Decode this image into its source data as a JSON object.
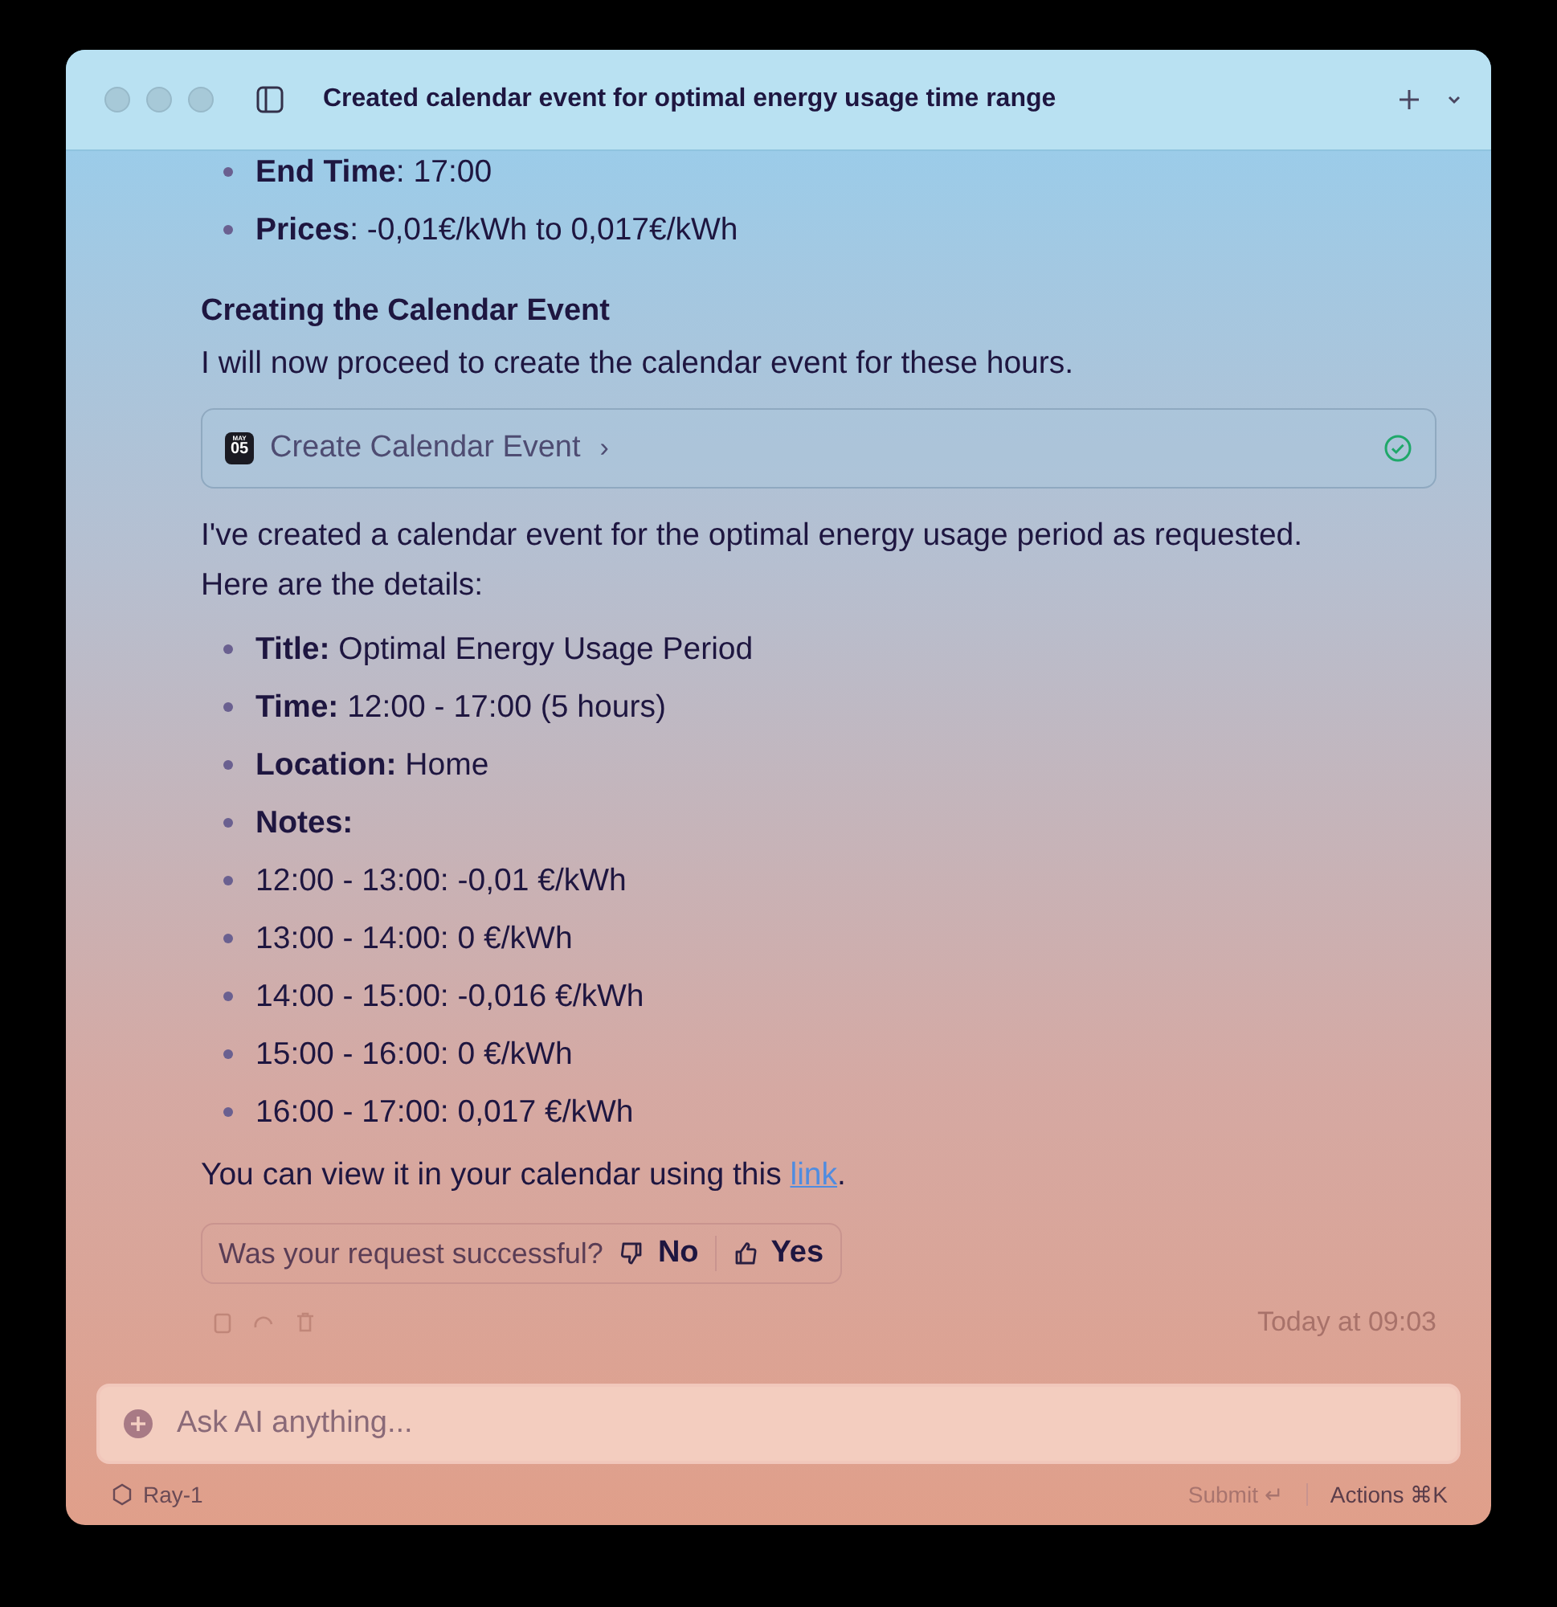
{
  "window": {
    "title": "Created calendar event for optimal energy usage time range"
  },
  "top_bullets": [
    "**End Time**: 17:00",
    "**Prices**: -0,01€/kWh to 0,017€/kWh"
  ],
  "heading": "Creating the Calendar Event",
  "intro": "I will now proceed to create the calendar event for these hours.",
  "tool_call": {
    "month": "MAY",
    "day": "05",
    "label": "Create Calendar Event",
    "chevron": "›",
    "done": true
  },
  "summary": "I've created a calendar event for the optimal energy usage period as requested. Here are the details:",
  "details": [
    "**Title:** Optimal Energy Usage Period",
    "**Time:** 12:00 - 17:00 (5 hours)",
    "**Location:** Home",
    "**Notes:**",
    "12:00 - 13:00: -0,01 €/kWh",
    "13:00 - 14:00: 0 €/kWh",
    "14:00 - 15:00: -0,016 €/kWh",
    "15:00 - 16:00: 0 €/kWh",
    "16:00 - 17:00: 0,017 €/kWh"
  ],
  "closing": {
    "text": "You can view it in your calendar using this ",
    "link": "link",
    "end": "."
  },
  "feedback": {
    "question": "Was your request successful?",
    "no": "No",
    "yes": "Yes"
  },
  "timestamp": "Today at 09:03",
  "input": {
    "placeholder": "Ask AI anything..."
  },
  "footer": {
    "model": "Ray-1",
    "submit": "Submit ↵",
    "submit_disabled": true,
    "actions": "Actions ⌘K"
  }
}
